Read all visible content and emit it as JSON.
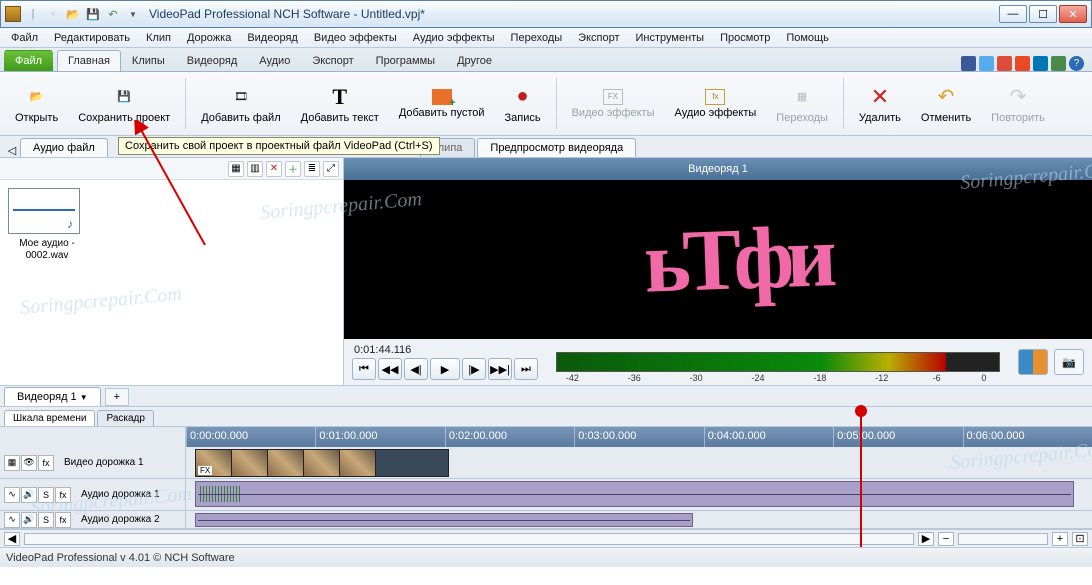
{
  "window": {
    "title": "VideoPad Professional NCH Software - Untitled.vpj*"
  },
  "menubar": [
    "Файл",
    "Редактировать",
    "Клип",
    "Дорожка",
    "Видеоряд",
    "Видео эффекты",
    "Аудио эффекты",
    "Переходы",
    "Экспорт",
    "Инструменты",
    "Просмотр",
    "Помощь"
  ],
  "ribbon_tabs": {
    "file": "Файл",
    "items": [
      "Главная",
      "Клипы",
      "Видеоряд",
      "Аудио",
      "Экспорт",
      "Программы",
      "Другое"
    ],
    "active": "Главная"
  },
  "ribbon": {
    "open": "Открыть",
    "save": "Сохранить проект",
    "add_file": "Добавить файл",
    "add_text": "Добавить текст",
    "add_blank": "Добавить пустой",
    "record": "Запись",
    "video_fx": "Видео эффекты",
    "audio_fx": "Аудио эффекты",
    "transitions": "Переходы",
    "delete": "Удалить",
    "undo": "Отменить",
    "redo": "Повторить"
  },
  "tooltip": "Сохранить свой проект в проектный файл VideoPad (Ctrl+S)",
  "bin_tabs": {
    "left": "Аудио файл",
    "mid": " клипа",
    "right": "Предпросмотр видеоряда"
  },
  "clip": {
    "name": "Мое аудио - 0002.wav"
  },
  "preview": {
    "title": "Видеоряд 1",
    "timecode": "0:01:44.116",
    "text_overlay": "ьТфи"
  },
  "vu_ticks": [
    "-42",
    "-36",
    "-30",
    "-24",
    "-18",
    "-12",
    "-6",
    "0"
  ],
  "sequence_tab": "Видеоряд 1",
  "timeline": {
    "mode_tabs": [
      "Шкала времени",
      "Раскадр"
    ],
    "ruler": [
      "0:00:00.000",
      "0:01:00.000",
      "0:02:00.000",
      "0:03:00.000",
      "0:04:00.000",
      "0:05:00.000",
      "0:06:00.000"
    ],
    "video_track": "Видео дорожка 1",
    "audio_track1": "Аудио дорожка 1",
    "audio_track2": "Аудио дорожка 2"
  },
  "statusbar": "VideoPad Professional v 4.01 © NCH Software",
  "watermark": "Soringpcrepair.Com"
}
